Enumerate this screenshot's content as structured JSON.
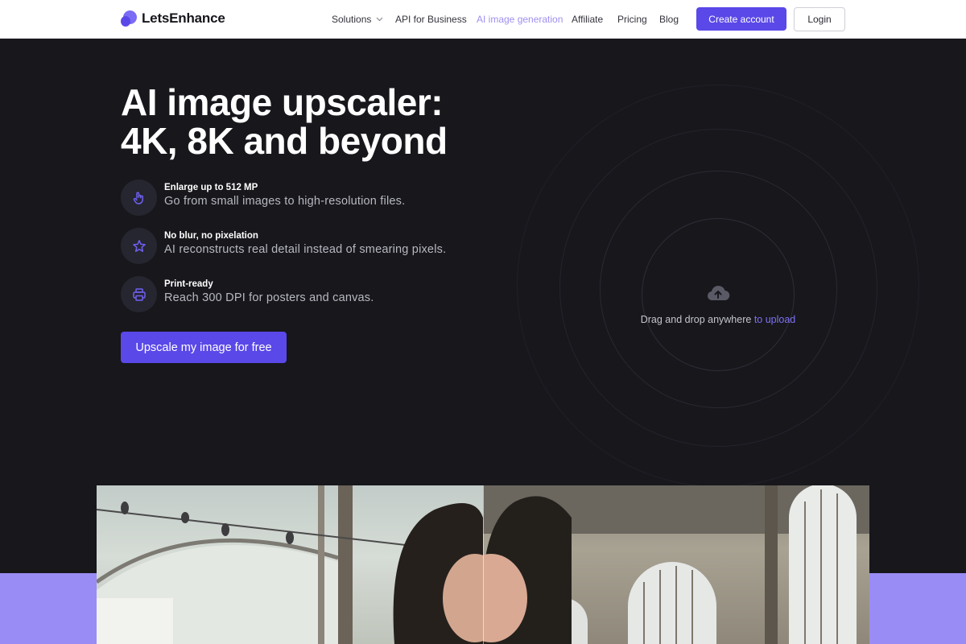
{
  "header": {
    "logo_text": "LetsEnhance",
    "nav": {
      "solutions": "Solutions",
      "api": "API for Business",
      "ai_generation": "AI image generation",
      "affiliate": "Affiliate",
      "pricing": "Pricing",
      "blog": "Blog"
    },
    "create_account": "Create account",
    "login": "Login"
  },
  "hero": {
    "title_line1": "AI image upscaler:",
    "title_line2": "4K, 8K and beyond",
    "features": [
      {
        "icon": "hand-pointer-icon",
        "title": "Enlarge up to 512 MP",
        "desc": "Go from small images to high-resolution files."
      },
      {
        "icon": "star-icon",
        "title": "No blur, no pixelation",
        "desc": "AI reconstructs real detail instead of smearing pixels."
      },
      {
        "icon": "printer-icon",
        "title": "Print-ready",
        "desc": "Reach 300 DPI for posters and canvas."
      }
    ],
    "cta": "Upscale my image for free"
  },
  "upload": {
    "icon": "cloud-upload-icon",
    "text": "Drag and drop anywhere",
    "link": "to upload"
  },
  "colors": {
    "accent": "#5a48e8",
    "background": "#17171c",
    "band": "#9a8cf5",
    "link": "#7f71f2"
  }
}
